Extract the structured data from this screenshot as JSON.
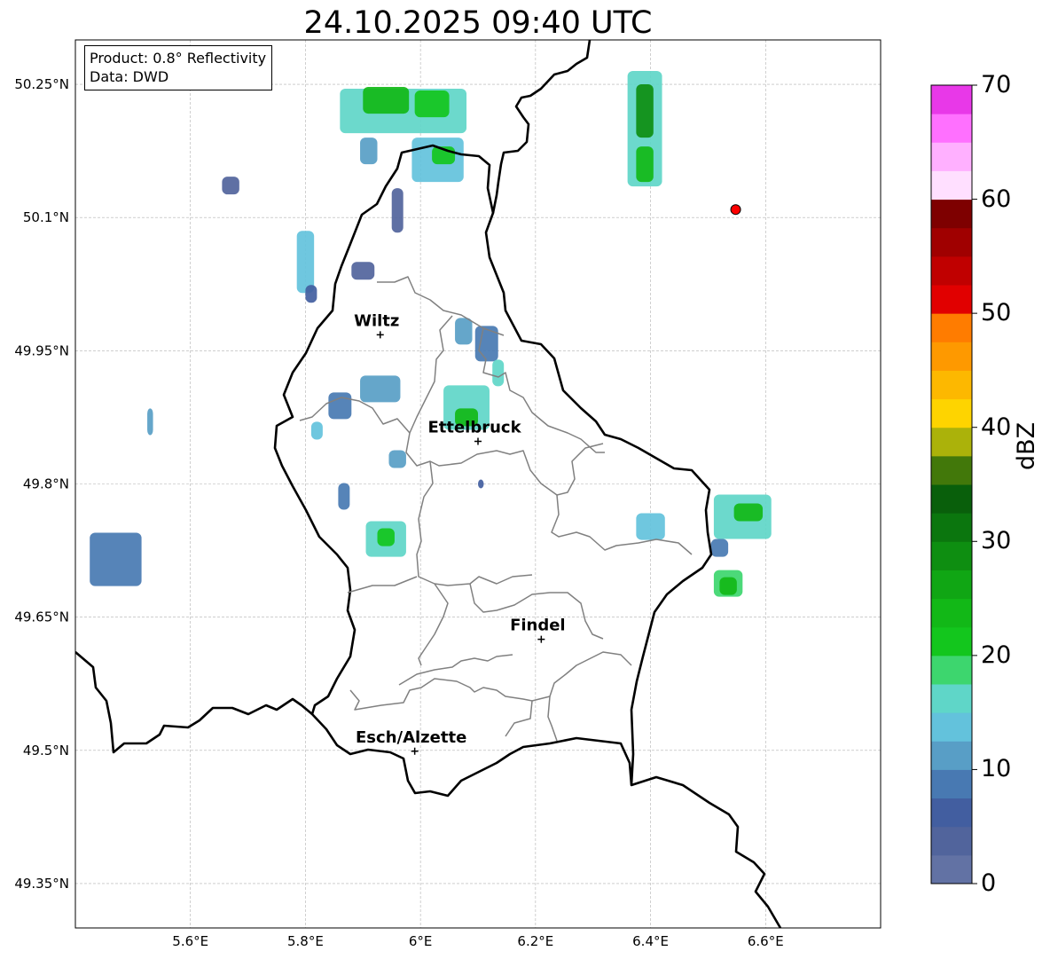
{
  "title": "24.10.2025 09:40 UTC",
  "legend": {
    "product": "Product: 0.8° Reflectivity",
    "source": "Data: DWD"
  },
  "map": {
    "lon_range": [
      5.4,
      6.8
    ],
    "lat_range": [
      49.3,
      50.3
    ],
    "lon_ticks": [
      {
        "value": 5.6,
        "label": "5.6°E"
      },
      {
        "value": 5.8,
        "label": "5.8°E"
      },
      {
        "value": 6.0,
        "label": "6°E"
      },
      {
        "value": 6.2,
        "label": "6.2°E"
      },
      {
        "value": 6.4,
        "label": "6.4°E"
      },
      {
        "value": 6.6,
        "label": "6.6°E"
      }
    ],
    "lat_ticks": [
      {
        "value": 50.25,
        "label": "50.25°N"
      },
      {
        "value": 50.1,
        "label": "50.1°N"
      },
      {
        "value": 49.95,
        "label": "49.95°N"
      },
      {
        "value": 49.8,
        "label": "49.8°N"
      },
      {
        "value": 49.65,
        "label": "49.65°N"
      },
      {
        "value": 49.5,
        "label": "49.5°N"
      },
      {
        "value": 49.35,
        "label": "49.35°N"
      }
    ],
    "gridlines": true,
    "cities": [
      {
        "name": "Wiltz",
        "lon": 5.93,
        "lat": 49.968
      },
      {
        "name": "Ettelbruck",
        "lon": 6.1,
        "lat": 49.848
      },
      {
        "name": "Findel",
        "lon": 6.21,
        "lat": 49.625
      },
      {
        "name": "Esch/Alzette",
        "lon": 5.99,
        "lat": 49.499
      }
    ],
    "radar_site": {
      "lon": 6.548,
      "lat": 50.109,
      "color": "#ff0000"
    }
  },
  "colorbar": {
    "label": "dBZ",
    "min": 0,
    "max": 70,
    "ticks": [
      "0",
      "10",
      "20",
      "30",
      "40",
      "50",
      "60",
      "70"
    ],
    "colors": [
      "#6272a4",
      "#51649c",
      "#425ea0",
      "#4879b2",
      "#589ec6",
      "#63c2dc",
      "#5fd6c8",
      "#3dd66e",
      "#13c61d",
      "#12b817",
      "#10a614",
      "#0e8e11",
      "#0b760e",
      "#095f0b",
      "#42780a",
      "#abb20a",
      "#fed400",
      "#fdb800",
      "#fe9900",
      "#ff7c00",
      "#e10000",
      "#c00000",
      "#a00000",
      "#7e0000",
      "#ffdfff",
      "#ffb0ff",
      "#ff70ff",
      "#e838e8"
    ]
  },
  "chart_data": {
    "type": "heatmap",
    "title": "24.10.2025 09:40 UTC",
    "xlabel": "",
    "ylabel": "",
    "xlim": [
      5.4,
      6.8
    ],
    "ylim": [
      49.3,
      50.3
    ],
    "value_label": "dBZ",
    "value_range": [
      0,
      70
    ],
    "echo_cells": [
      {
        "lon": 5.97,
        "lat": 50.22,
        "w": 0.22,
        "h": 0.05,
        "dbz": 15
      },
      {
        "lon": 5.94,
        "lat": 50.232,
        "w": 0.08,
        "h": 0.03,
        "dbz": 23
      },
      {
        "lon": 6.02,
        "lat": 50.228,
        "w": 0.06,
        "h": 0.03,
        "dbz": 21
      },
      {
        "lon": 6.03,
        "lat": 50.165,
        "w": 0.09,
        "h": 0.05,
        "dbz": 13
      },
      {
        "lon": 6.04,
        "lat": 50.17,
        "w": 0.04,
        "h": 0.02,
        "dbz": 22
      },
      {
        "lon": 5.91,
        "lat": 50.175,
        "w": 0.03,
        "h": 0.03,
        "dbz": 11
      },
      {
        "lon": 5.67,
        "lat": 50.136,
        "w": 0.03,
        "h": 0.02,
        "dbz": 4
      },
      {
        "lon": 5.96,
        "lat": 50.108,
        "w": 0.02,
        "h": 0.05,
        "dbz": 4
      },
      {
        "lon": 5.8,
        "lat": 50.05,
        "w": 0.03,
        "h": 0.07,
        "dbz": 13
      },
      {
        "lon": 5.9,
        "lat": 50.04,
        "w": 0.04,
        "h": 0.02,
        "dbz": 4
      },
      {
        "lon": 5.81,
        "lat": 50.014,
        "w": 0.02,
        "h": 0.02,
        "dbz": 6
      },
      {
        "lon": 6.39,
        "lat": 50.2,
        "w": 0.06,
        "h": 0.13,
        "dbz": 17
      },
      {
        "lon": 6.39,
        "lat": 50.22,
        "w": 0.03,
        "h": 0.06,
        "dbz": 29
      },
      {
        "lon": 6.39,
        "lat": 50.16,
        "w": 0.03,
        "h": 0.04,
        "dbz": 23
      },
      {
        "lon": 6.075,
        "lat": 49.972,
        "w": 0.03,
        "h": 0.03,
        "dbz": 12
      },
      {
        "lon": 6.115,
        "lat": 49.958,
        "w": 0.04,
        "h": 0.04,
        "dbz": 9
      },
      {
        "lon": 6.135,
        "lat": 49.925,
        "w": 0.02,
        "h": 0.03,
        "dbz": 17
      },
      {
        "lon": 6.08,
        "lat": 49.886,
        "w": 0.08,
        "h": 0.05,
        "dbz": 16
      },
      {
        "lon": 6.08,
        "lat": 49.875,
        "w": 0.04,
        "h": 0.02,
        "dbz": 23
      },
      {
        "lon": 5.93,
        "lat": 49.907,
        "w": 0.07,
        "h": 0.03,
        "dbz": 12
      },
      {
        "lon": 5.86,
        "lat": 49.888,
        "w": 0.04,
        "h": 0.03,
        "dbz": 9
      },
      {
        "lon": 5.82,
        "lat": 49.86,
        "w": 0.02,
        "h": 0.02,
        "dbz": 14
      },
      {
        "lon": 5.96,
        "lat": 49.828,
        "w": 0.03,
        "h": 0.02,
        "dbz": 10
      },
      {
        "lon": 6.105,
        "lat": 49.8,
        "w": 0.01,
        "h": 0.01,
        "dbz": 5
      },
      {
        "lon": 5.867,
        "lat": 49.786,
        "w": 0.02,
        "h": 0.03,
        "dbz": 9
      },
      {
        "lon": 5.94,
        "lat": 49.738,
        "w": 0.07,
        "h": 0.04,
        "dbz": 15
      },
      {
        "lon": 5.94,
        "lat": 49.74,
        "w": 0.03,
        "h": 0.02,
        "dbz": 22
      },
      {
        "lon": 5.47,
        "lat": 49.715,
        "w": 0.09,
        "h": 0.06,
        "dbz": 8
      },
      {
        "lon": 5.53,
        "lat": 49.87,
        "w": 0.01,
        "h": 0.03,
        "dbz": 10
      },
      {
        "lon": 6.4,
        "lat": 49.752,
        "w": 0.05,
        "h": 0.03,
        "dbz": 14
      },
      {
        "lon": 6.56,
        "lat": 49.763,
        "w": 0.1,
        "h": 0.05,
        "dbz": 16
      },
      {
        "lon": 6.57,
        "lat": 49.768,
        "w": 0.05,
        "h": 0.02,
        "dbz": 24
      },
      {
        "lon": 6.52,
        "lat": 49.728,
        "w": 0.03,
        "h": 0.02,
        "dbz": 9
      },
      {
        "lon": 6.535,
        "lat": 49.688,
        "w": 0.05,
        "h": 0.03,
        "dbz": 18
      },
      {
        "lon": 6.535,
        "lat": 49.685,
        "w": 0.03,
        "h": 0.02,
        "dbz": 24
      }
    ]
  }
}
